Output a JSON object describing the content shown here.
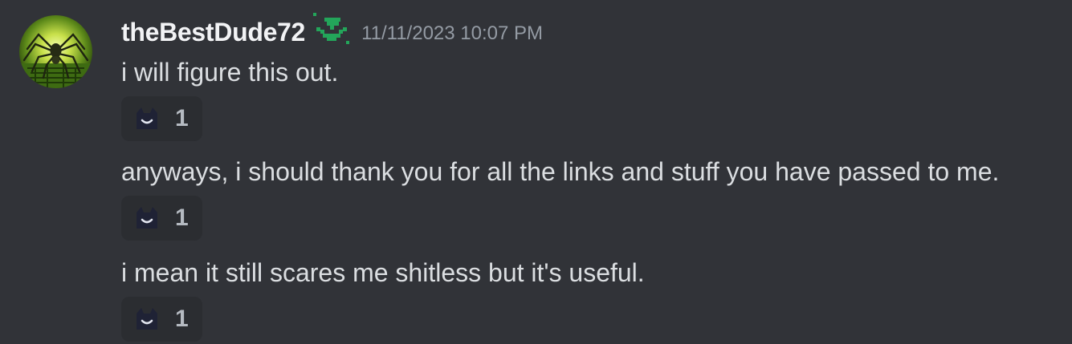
{
  "message_group": {
    "author": "theBestDude72",
    "timestamp": "11/11/2023 10:07 PM",
    "role_icon": "green-plant-pixel-icon",
    "avatar_icon": "spider-avatar-icon",
    "colors": {
      "background": "#313338",
      "username": "#f2f3f5",
      "message_text": "#dbdee1",
      "timestamp": "#949ba4",
      "reaction_bg": "#2b2d31",
      "role_icon": "#23a55a"
    },
    "messages": [
      {
        "text": "i will figure this out.",
        "reaction": {
          "emoji": "smiling-cat-emoji-icon",
          "count": "1"
        }
      },
      {
        "text": "anyways, i should thank you for all the links and stuff you have passed to me.",
        "reaction": {
          "emoji": "smiling-cat-emoji-icon",
          "count": "1"
        }
      },
      {
        "text": "i mean it still scares me shitless but it's useful.",
        "reaction": {
          "emoji": "smiling-cat-emoji-icon",
          "count": "1"
        }
      }
    ]
  }
}
